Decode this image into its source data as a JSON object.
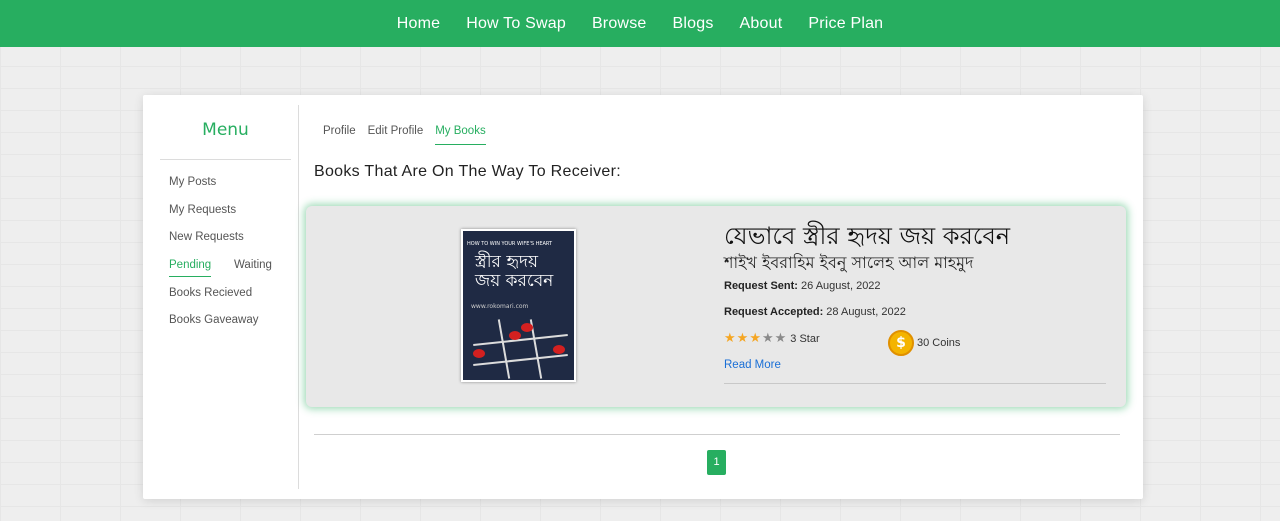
{
  "nav": {
    "items": [
      "Home",
      "How To Swap",
      "Browse",
      "Blogs",
      "About",
      "Price Plan"
    ]
  },
  "sidebar": {
    "title": "Menu",
    "items": {
      "my_posts": "My Posts",
      "my_requests": "My Requests",
      "new_requests": "New Requests",
      "pending": "Pending",
      "waiting": "Waiting",
      "books_received": "Books Recieved",
      "books_giveaway": "Books Gaveaway"
    }
  },
  "tabs": [
    "Profile",
    "Edit Profile",
    "My Books"
  ],
  "section": {
    "title": "Books That Are On The Way To Receiver:"
  },
  "book": {
    "title": "যেভাবে স্ত্রীর হৃদয় জয় করবেন",
    "author": "শাইখ ইবরাহিম ইবনু সালেহ আল মাহমুদ",
    "cover": {
      "top_text": "HOW TO WIN YOUR WIFE'S HEART",
      "title_line1": "স্ত্রীর হৃদয়",
      "title_line2": "জয় করবেন",
      "site": "www.rokomari.com"
    },
    "request_sent_label": "Request Sent:",
    "request_sent_value": "26 August, 2022",
    "request_accepted_label": "Request Accepted:",
    "request_accepted_value": "28 August, 2022",
    "rating": 3,
    "rating_max": 5,
    "rating_label": "3 Star",
    "coins_label": "30 Coins",
    "read_more": "Read More"
  },
  "pagination": {
    "current": "1"
  },
  "colors": {
    "brand": "#27ae60",
    "link": "#1a6fd6",
    "star": "#f5a623",
    "coin": "#f4b400"
  }
}
